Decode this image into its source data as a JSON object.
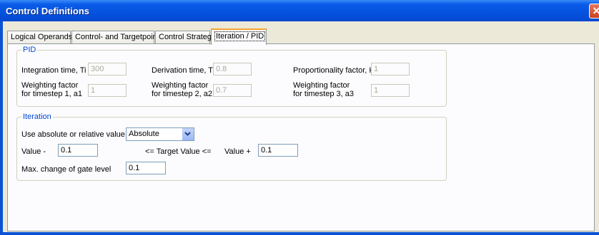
{
  "window": {
    "title": "Control Definitions",
    "close_glyph": "✕"
  },
  "tabs": [
    {
      "label": "Logical Operands"
    },
    {
      "label": "Control- and Targetpoint"
    },
    {
      "label": "Control Strategy"
    },
    {
      "label": "Iteration / PID",
      "active": true
    }
  ],
  "pid": {
    "legend": "PID",
    "integration_label": "Integration time, Ti",
    "integration_value": "300",
    "derivation_label": "Derivation time, Td",
    "derivation_value": "0.8",
    "proportionality_label": "Proportionality factor, K",
    "proportionality_value": "1",
    "w1_label_line1": "Weighting factor",
    "w1_label_line2": "for timestep 1, a1",
    "w1_value": "1",
    "w2_label_line1": "Weighting factor",
    "w2_label_line2": "for timestep 2, a2",
    "w2_value": "0.7",
    "w3_label_line1": "Weighting factor",
    "w3_label_line2": "for timestep 3, a3",
    "w3_value": "1"
  },
  "iteration": {
    "legend": "Iteration",
    "mode_label": "Use absolute or relative value",
    "mode_value": "Absolute",
    "value_minus_label": "Value -",
    "value_minus": "0.1",
    "target_label": "<= Target Value <=",
    "value_plus_label": "Value +",
    "value_plus": "0.1",
    "max_change_label": "Max. change of gate level",
    "max_change": "0.1"
  }
}
